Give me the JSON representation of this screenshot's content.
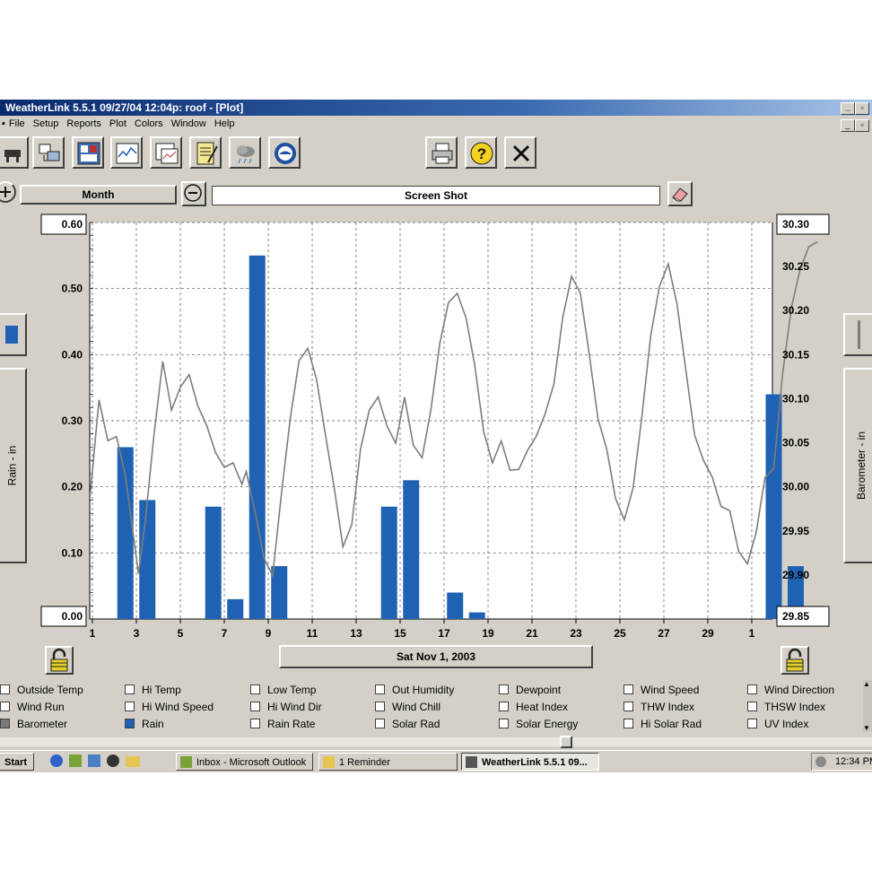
{
  "window": {
    "title": "WeatherLink 5.5.1  09/27/04  12:04p: roof - [Plot]",
    "menu": [
      "File",
      "Setup",
      "Reports",
      "Plot",
      "Colors",
      "Window",
      "Help"
    ]
  },
  "toolbar": {
    "left_icons": [
      "bulletin-icon",
      "download-icon",
      "summary-icon",
      "strip-chart-icon",
      "plot-icon",
      "notes-icon",
      "weather-icon",
      "noaa-icon"
    ],
    "right_icons": [
      "print-icon",
      "help-icon",
      "exit-icon"
    ]
  },
  "controls": {
    "span_label": "Month",
    "comment": "Screen Shot"
  },
  "plot": {
    "left_axis_title": "Rain - in",
    "right_axis_title": "Barometer - in",
    "date_label": "Sat Nov 1, 2003",
    "colors": {
      "rain": "#1f62b4",
      "barometer": "#7d7d7d",
      "grid": "#555555"
    }
  },
  "chart_data": {
    "type": "bar",
    "x_tick_labels": [
      "1",
      "3",
      "5",
      "7",
      "9",
      "11",
      "13",
      "15",
      "17",
      "19",
      "21",
      "23",
      "25",
      "27",
      "29",
      "1"
    ],
    "y_left": {
      "label": "Rain - in",
      "ylim": [
        0,
        0.6
      ],
      "ticks": [
        "0.00",
        "0.10",
        "0.20",
        "0.30",
        "0.40",
        "0.50",
        "0.60"
      ]
    },
    "y_right": {
      "label": "Barometer - in",
      "ylim": [
        29.85,
        30.3
      ],
      "ticks": [
        "29.85",
        "29.90",
        "29.95",
        "30.00",
        "30.05",
        "30.10",
        "30.15",
        "30.20",
        "30.25",
        "30.30"
      ]
    },
    "series": [
      {
        "name": "Rain",
        "x": [
          2.5,
          3.5,
          6.5,
          7.5,
          8.5,
          9.5,
          14.5,
          15.5,
          17.5,
          18.5,
          32.0,
          33.0
        ],
        "values": [
          0.26,
          0.18,
          0.17,
          0.03,
          0.55,
          0.08,
          0.17,
          0.21,
          0.04,
          0.01,
          0.34,
          0.08
        ]
      },
      {
        "name": "Barometer",
        "x": [
          0.9,
          1.3,
          1.7,
          2.1,
          2.5,
          2.9,
          3.1,
          3.4,
          3.8,
          4.2,
          4.6,
          5.0,
          5.4,
          5.8,
          6.2,
          6.6,
          7.0,
          7.4,
          7.8,
          8.0,
          8.4,
          8.8,
          9.2,
          9.6,
          10.0,
          10.4,
          10.8,
          11.2,
          11.6,
          12.0,
          12.4,
          12.8,
          13.2,
          13.6,
          14.0,
          14.4,
          14.8,
          15.2,
          15.6,
          16.0,
          16.4,
          16.8,
          17.2,
          17.6,
          18.0,
          18.4,
          18.8,
          19.2,
          19.6,
          20.0,
          20.4,
          20.8,
          21.2,
          21.6,
          22.0,
          22.4,
          22.8,
          23.2,
          23.6,
          24.0,
          24.4,
          24.8,
          25.2,
          25.6,
          26.0,
          26.4,
          26.8,
          27.2,
          27.6,
          28.0,
          28.4,
          28.8,
          29.2,
          29.6,
          30.0,
          30.4,
          30.8,
          31.2,
          31.6,
          32.0,
          32.4,
          32.8,
          33.2,
          33.6,
          34.0
        ],
        "values": [
          29.99,
          30.1,
          30.05,
          30.06,
          30.01,
          29.94,
          29.9,
          29.96,
          30.06,
          30.14,
          30.09,
          30.11,
          30.13,
          30.09,
          30.07,
          30.04,
          30.02,
          30.03,
          30.0,
          30.02,
          29.97,
          29.92,
          29.9,
          29.99,
          30.08,
          30.14,
          30.16,
          30.12,
          30.06,
          30.0,
          29.93,
          29.96,
          30.04,
          30.09,
          30.1,
          30.07,
          30.05,
          30.1,
          30.05,
          30.03,
          30.09,
          30.16,
          30.21,
          30.22,
          30.19,
          30.14,
          30.06,
          30.03,
          30.05,
          30.02,
          30.02,
          30.04,
          30.06,
          30.08,
          30.12,
          30.19,
          30.24,
          30.22,
          30.15,
          30.08,
          30.04,
          29.99,
          29.96,
          30.0,
          30.08,
          30.17,
          30.23,
          30.25,
          30.21,
          30.13,
          30.06,
          30.03,
          30.01,
          29.98,
          29.97,
          29.93,
          29.91,
          29.95,
          30.01,
          30.02,
          30.13,
          30.2,
          30.25,
          30.27,
          30.28
        ]
      }
    ],
    "grid": true
  },
  "legend": [
    [
      "Outside Temp",
      "Hi Temp",
      "Low Temp",
      "Out Humidity",
      "Dewpoint",
      "Wind Speed",
      "Wind Direction"
    ],
    [
      "Wind Run",
      "Hi Wind Speed",
      "Hi Wind Dir",
      "Wind Chill",
      "Heat Index",
      "THW Index",
      "THSW Index"
    ],
    [
      "Barometer",
      "Rain",
      "Rain Rate",
      "Solar Rad",
      "Solar Energy",
      "Hi Solar Rad",
      "UV Index"
    ]
  ],
  "taskbar": {
    "start": "Start",
    "tasks": [
      "Inbox - Microsoft Outlook",
      "1 Reminder",
      "WeatherLink 5.5.1  09..."
    ],
    "clock": "12:34 PM"
  }
}
